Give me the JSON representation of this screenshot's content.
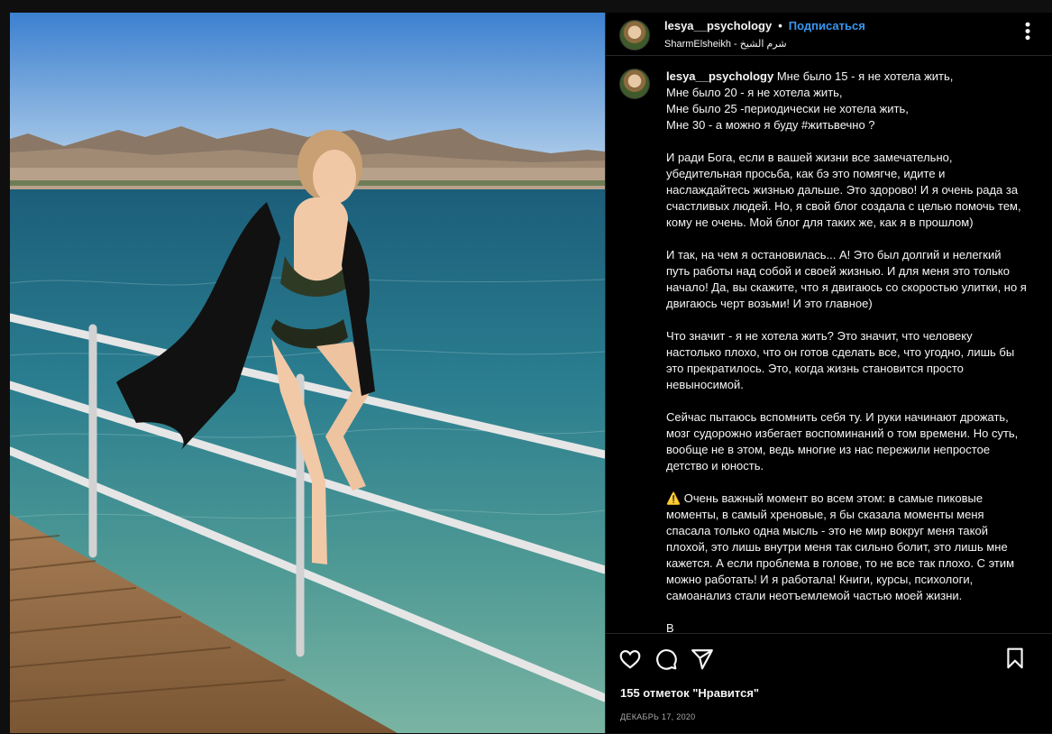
{
  "photo": {
    "alt": ""
  },
  "header": {
    "username": "lesya__psychology",
    "separator": "•",
    "follow_label": "Подписаться",
    "location": "SharmElsheikh - شرم الشيخ",
    "more_icon": "more-horizontal-icon"
  },
  "caption": {
    "username": "lesya__psychology",
    "text": " Мне было 15 - я не хотела жить,\nМне было 20 - я не хотела жить,\nМне было 25 -периодически не хотела жить,\nМне 30 - а можно я буду #житьвечно ?\n\nИ ради Бога, если в вашей жизни все замечательно, убедительная просьба, как бэ это помягче, идите и наслаждайтесь жизнью дальше. Это здорово! И я очень рада за счастливых людей. Но, я свой блог создала с целью помочь тем, кому не очень. Мой блог для таких же, как я в прошлом)\n\nИ так, на чем я остановилась... А! Это был долгий и нелегкий путь работы над собой и своей жизнью. И для меня это только начало! Да, вы скажите, что я двигаюсь со скоростью улитки, но я двигаюсь черт возьми! И это главное)\n\nЧто значит - я не хотела жить? Это значит, что человеку настолько плохо, что он готов сделать все, что угодно, лишь бы это прекратилось. Это, когда жизнь становится просто невыносимой.\n\nСейчас пытаюсь вспомнить себя ту. И руки начинают дрожать, мозг судорожно избегает воспоминаний о том времени. Но суть, вообще не в этом, ведь многие из нас пережили непростое детство и юность.\n\n⚠️ Очень важный момент во всем этом: в самые пиковые моменты, в самый хреновые, я бы сказала моменты меня спасала только одна мысль - это не мир вокруг меня такой плохой, это лишь внутри меня так сильно болит, это лишь мне кажется. А если проблема в голове, то не все так плохо. С этим можно работать! И я работала! Книги, курсы, психологи, самоанализ стали неотъемлемой частью моей жизни.\n\nВ"
  },
  "actions": {
    "like_icon": "heart-icon",
    "comment_icon": "comment-icon",
    "share_icon": "paper-plane-icon",
    "save_icon": "bookmark-icon",
    "likes_text": "155 отметок \"Нравится\"",
    "date": "ДЕКАБРЬ 17, 2020"
  }
}
